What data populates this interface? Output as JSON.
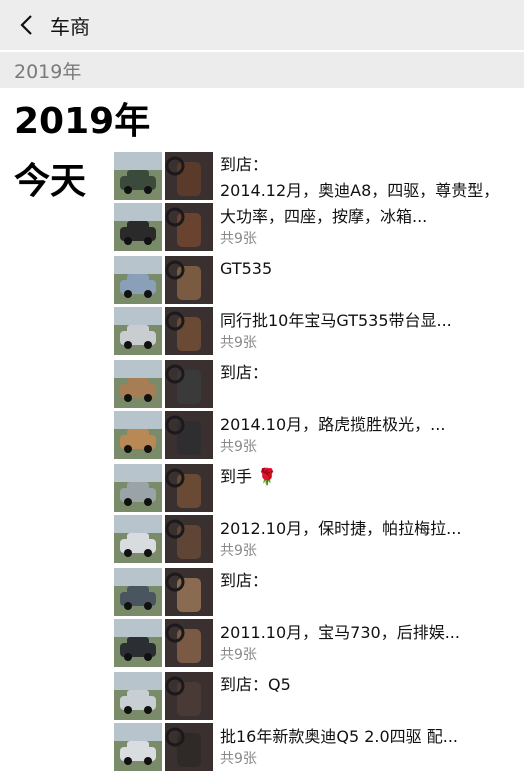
{
  "nav": {
    "title": "车商"
  },
  "section": {
    "label": "2019年"
  },
  "year_heading": "2019年",
  "day_label": "今天",
  "posts": [
    {
      "line1": "到店：",
      "line2": "  2014.12月，奥迪A8，四驱，尊贵型，大功率，四座，按摩，冰箱...",
      "count": "共9张",
      "colors": [
        "#3b4a3a",
        "#5a3a2a",
        "#2a2a2a",
        "#6a4330"
      ]
    },
    {
      "line1": "GT535",
      "line2": "  同行批10年宝马GT535带台显...",
      "count": "共9张",
      "colors": [
        "#8aa0b8",
        "#7a5a40",
        "#c9cdd0",
        "#6b4a35"
      ]
    },
    {
      "line1": "到店：",
      "line2": "      2014.10月，路虎揽胜极光，...",
      "count": "共9张",
      "colors": [
        "#a77d55",
        "#3a3a3a",
        "#b88955",
        "#2e2e30"
      ]
    },
    {
      "line1": "到手 🌹",
      "line2": "    2012.10月，保时捷，帕拉梅拉...",
      "count": "共9张",
      "colors": [
        "#9aa3a8",
        "#6a4a35",
        "#d8dcdf",
        "#5e4535"
      ]
    },
    {
      "line1": "到店：",
      "line2": "    2011.10月，宝马730，后排娱...",
      "count": "共9张",
      "colors": [
        "#4a5560",
        "#8a6a50",
        "#2b2f33",
        "#7a5a45"
      ]
    },
    {
      "line1": "到店：Q5",
      "line2": " 批16年新款奥迪Q5  2.0四驱  配...",
      "count": "共9张",
      "colors": [
        "#c8cfd4",
        "#4a3a35",
        "#d9dde0",
        "#2f2a28"
      ]
    }
  ]
}
